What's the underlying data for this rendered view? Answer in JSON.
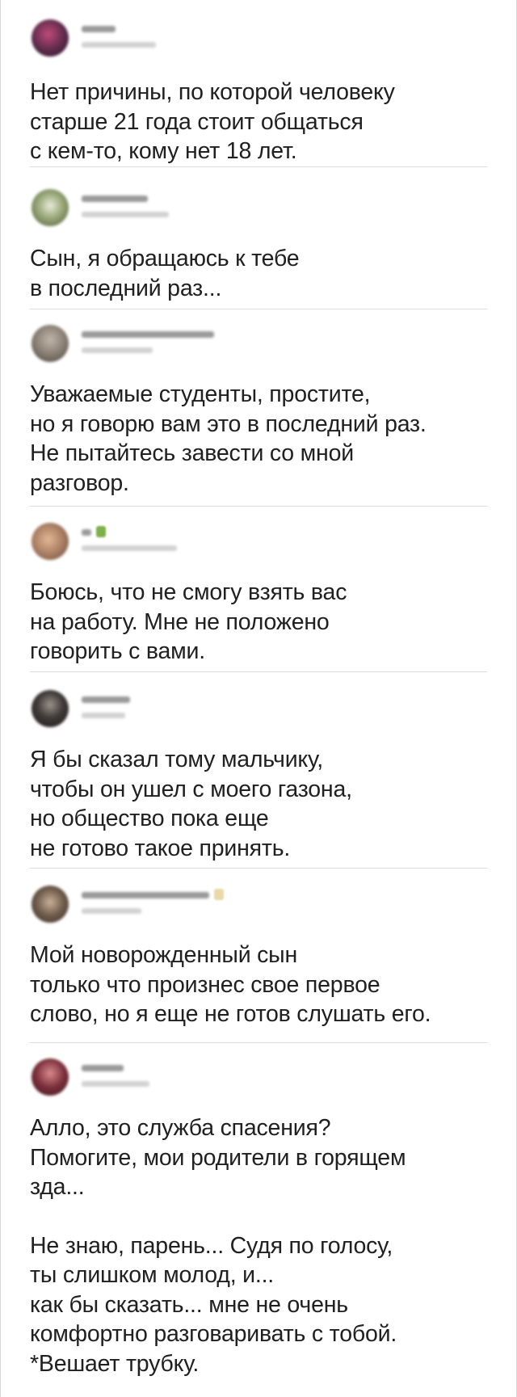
{
  "tweets": [
    {
      "text": "Нет причины, по которой человеку\nстарше 21 года стоит общаться\nс кем-то, кому нет 18 лет.",
      "avatar_color": "#5a2a4a"
    },
    {
      "text": "Сын, я обращаюсь к тебе\nв последний раз...",
      "avatar_color": "#7c8c64"
    },
    {
      "text": "Уважаемые студенты, простите,\nно я говорю вам это в последний раз.\nНе пытайтесь завести со мной\nразговор.",
      "avatar_color": "#8a7f74"
    },
    {
      "text": "Боюсь, что не смогу взять вас\nна работу. Мне не положено\nговорить с вами.",
      "avatar_color": "#b08468"
    },
    {
      "text": "Я бы сказал тому мальчику,\nчтобы он ушел с моего газона,\nно общество пока еще\nне готово такое принять.",
      "avatar_color": "#3f3a38"
    },
    {
      "text": "Мой новорожденный сын\nтолько что произнес свое первое\nслово, но я еще не готов слушать его.",
      "avatar_color": "#6e5a4a"
    },
    {
      "text": "Алло, это служба спасения?\nПомогите, мои родители в горящем\nзда...",
      "reply": "Не знаю, парень... Судя по голосу,\nты слишком молод, и...\nкак бы сказать... мне не очень\nкомфортно разговаривать с тобой.\n*Вешает трубку.",
      "avatar_color": "#7a2e3a"
    }
  ]
}
